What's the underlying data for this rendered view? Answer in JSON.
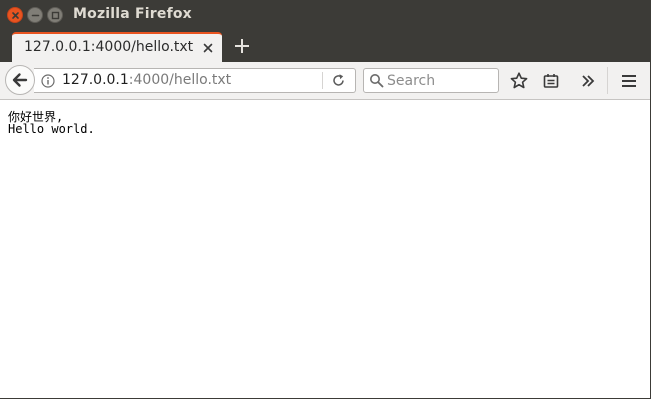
{
  "window": {
    "title": "Mozilla Firefox"
  },
  "tabs": [
    {
      "label": "127.0.0.1:4000/hello.txt",
      "active": true
    }
  ],
  "navbar": {
    "url_host": "127.0.0.1",
    "url_path": ":4000/hello.txt",
    "search_placeholder": "Search"
  },
  "content": {
    "lines": [
      "你好世界,",
      "Hello world."
    ]
  },
  "colors": {
    "titlebar": "#3c3b37",
    "close_button": "#e95420",
    "tab_accent": "#e95420",
    "toolbar": "#f2f1f0"
  },
  "icons": [
    "close-icon",
    "minimize-icon",
    "maximize-icon",
    "plus-icon",
    "back-arrow-icon",
    "info-icon",
    "reload-icon",
    "search-icon",
    "bookmark-star-icon",
    "reading-list-icon",
    "overflow-chevron-icon",
    "hamburger-menu-icon"
  ]
}
